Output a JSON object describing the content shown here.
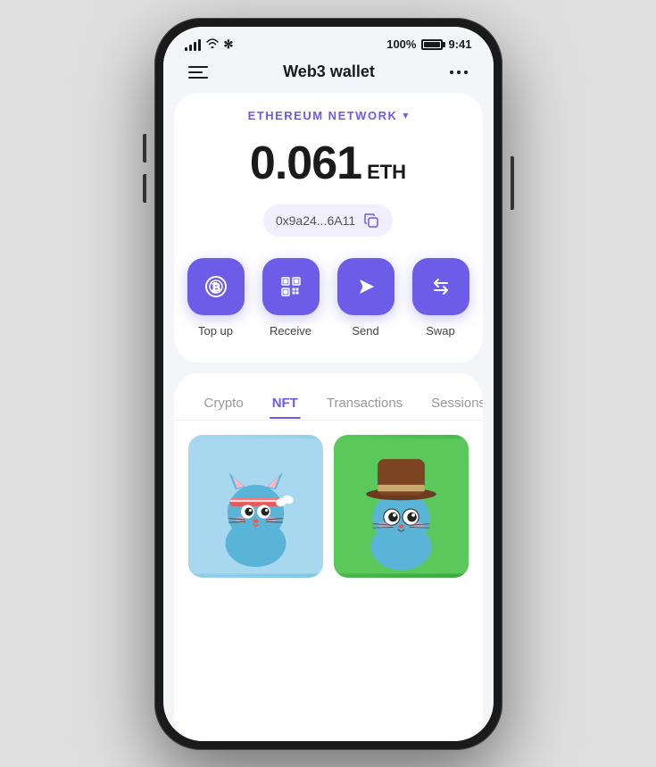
{
  "status_bar": {
    "battery_pct": "100%",
    "time": "9:41"
  },
  "header": {
    "title": "Web3 wallet",
    "menu_label": "menu",
    "more_label": "more options"
  },
  "network": {
    "label": "ETHEREUM NETWORK",
    "chevron": "▾"
  },
  "balance": {
    "amount": "0.061",
    "currency": "ETH"
  },
  "address": {
    "text": "0x9a24...6A11",
    "copy_label": "copy address"
  },
  "actions": [
    {
      "id": "topup",
      "label": "Top up",
      "icon": "topup-icon"
    },
    {
      "id": "receive",
      "label": "Receive",
      "icon": "receive-icon"
    },
    {
      "id": "send",
      "label": "Send",
      "icon": "send-icon"
    },
    {
      "id": "swap",
      "label": "Swap",
      "icon": "swap-icon"
    }
  ],
  "tabs": [
    {
      "id": "crypto",
      "label": "Crypto",
      "active": false
    },
    {
      "id": "nft",
      "label": "NFT",
      "active": true
    },
    {
      "id": "transactions",
      "label": "Transactions",
      "active": false
    },
    {
      "id": "sessions",
      "label": "Sessions",
      "active": false
    }
  ],
  "nft_items": [
    {
      "id": "nft-1",
      "theme": "blue"
    },
    {
      "id": "nft-2",
      "theme": "green"
    }
  ],
  "colors": {
    "accent": "#6c5ce7",
    "text_primary": "#1a1a1a",
    "text_secondary": "#999999"
  }
}
